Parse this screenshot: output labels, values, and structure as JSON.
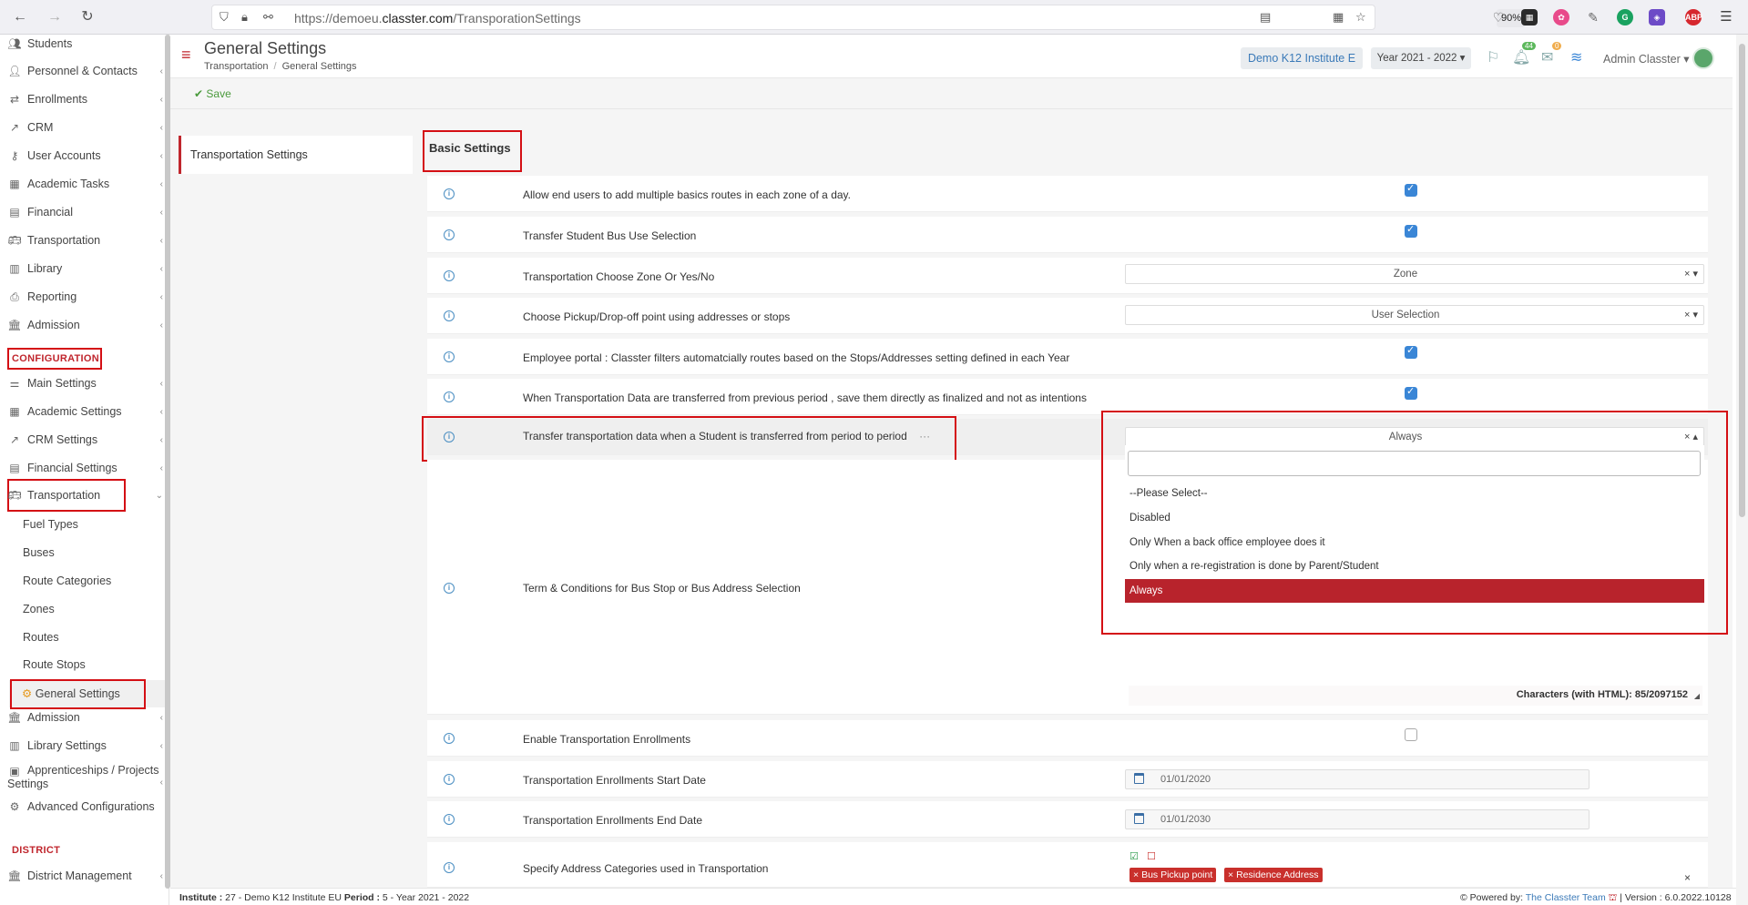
{
  "browser": {
    "url_prefix": "https://demoeu.",
    "url_domain": "classter.com",
    "url_path": "/TransporationSettings",
    "zoom": "90%"
  },
  "sidebar": {
    "top_items": [
      {
        "label": "Students",
        "icon": "users-icon"
      },
      {
        "label": "Personnel & Contacts",
        "icon": "contacts-icon"
      },
      {
        "label": "Enrollments",
        "icon": "exchange-icon"
      },
      {
        "label": "CRM",
        "icon": "chart-icon"
      },
      {
        "label": "User Accounts",
        "icon": "key-icon"
      },
      {
        "label": "Academic Tasks",
        "icon": "grid-icon"
      },
      {
        "label": "Financial",
        "icon": "money-icon"
      },
      {
        "label": "Transportation",
        "icon": "bus-icon"
      },
      {
        "label": "Library",
        "icon": "books-icon"
      },
      {
        "label": "Reporting",
        "icon": "printer-icon"
      },
      {
        "label": "Admission",
        "icon": "building-icon"
      }
    ],
    "config_section": "CONFIGURATION",
    "config_items": [
      {
        "label": "Main Settings",
        "icon": "sliders-icon"
      },
      {
        "label": "Academic Settings",
        "icon": "grid-icon"
      },
      {
        "label": "CRM Settings",
        "icon": "chart-icon"
      },
      {
        "label": "Financial Settings",
        "icon": "money-icon"
      },
      {
        "label": "Transportation",
        "icon": "bus-icon"
      }
    ],
    "transport_sub": [
      "Fuel Types",
      "Buses",
      "Route Categories",
      "Zones",
      "Routes",
      "Route Stops"
    ],
    "active_sub": "General Settings",
    "after_items": [
      {
        "label": "Admission",
        "icon": "building-icon"
      },
      {
        "label": "Library Settings",
        "icon": "books-icon"
      },
      {
        "label": "Apprenticeships / Projects",
        "label2": "Settings",
        "icon": "briefcase-icon"
      },
      {
        "label": "Advanced Configurations",
        "icon": "gear-icon"
      }
    ],
    "district_section": "DISTRICT",
    "district_items": [
      {
        "label": "District Management",
        "icon": "building-icon"
      }
    ]
  },
  "header": {
    "title": "General Settings",
    "breadcrumb": [
      "Transportation",
      "General Settings"
    ],
    "institute": "Demo K12 Institute E",
    "year": "Year 2021 - 2022",
    "notif_count": "44",
    "mail_count": "0",
    "user": "Admin Classter"
  },
  "toolbar": {
    "save_label": "Save"
  },
  "settings_nav": {
    "item": "Transportation Settings"
  },
  "panel": {
    "title": "Basic Settings",
    "rows": [
      {
        "label": "Allow end users to add multiple basics routes in each zone of a day.",
        "control": "checkbox",
        "checked": true
      },
      {
        "label": "Transfer Student Bus Use Selection",
        "control": "checkbox",
        "checked": true
      },
      {
        "label": "Transportation Choose Zone Or Yes/No",
        "control": "select",
        "value": "Zone"
      },
      {
        "label": "Choose Pickup/Drop-off point using addresses or stops",
        "control": "select",
        "value": "User Selection"
      },
      {
        "label": "Employee portal : Classter filters automatcially routes based on the Stops/Addresses setting defined in each Year",
        "control": "checkbox",
        "checked": true
      },
      {
        "label": "When Transportation Data are transferred from previous period , save them directly as finalized and not as intentions",
        "control": "checkbox",
        "checked": true
      },
      {
        "label": "Transfer transportation data when a Student is transferred from period to period",
        "control": "select",
        "value": "Always",
        "more": "···"
      },
      {
        "label": "Term & Conditions for Bus Stop or Bus Address Selection",
        "control": "editor",
        "char_count": "Characters (with HTML): 85/2097152"
      },
      {
        "label": "Enable Transportation Enrollments",
        "control": "checkbox",
        "checked": false
      },
      {
        "label": "Transportation Enrollments Start Date",
        "control": "date",
        "value": "01/01/2020"
      },
      {
        "label": "Transportation Enrollments End Date",
        "control": "date",
        "value": "01/01/2030"
      },
      {
        "label": "Specify Address Categories used in Transportation",
        "control": "tags",
        "tags": [
          "Bus Pickup point",
          "Residence Address"
        ]
      }
    ]
  },
  "dropdown": {
    "options": [
      "--Please Select--",
      "Disabled",
      "Only When a back office employee does it",
      "Only when a re-registration is done by Parent/Student",
      "Always"
    ],
    "selected_index": 4
  },
  "footer": {
    "institute_label": "Institute :",
    "institute_value": "27 - Demo K12 Institute EU",
    "period_label": "Period :",
    "period_value": "5 - Year 2021 - 2022",
    "powered_label": "Powered by:",
    "powered_by": "The Classter Team",
    "version": "| Version : 6.0.2022.10128"
  },
  "colors": {
    "accent": "#c0262d",
    "link": "#3b7ab8",
    "checkbox": "#3a86d6",
    "highlight_box": "#d40f14"
  }
}
